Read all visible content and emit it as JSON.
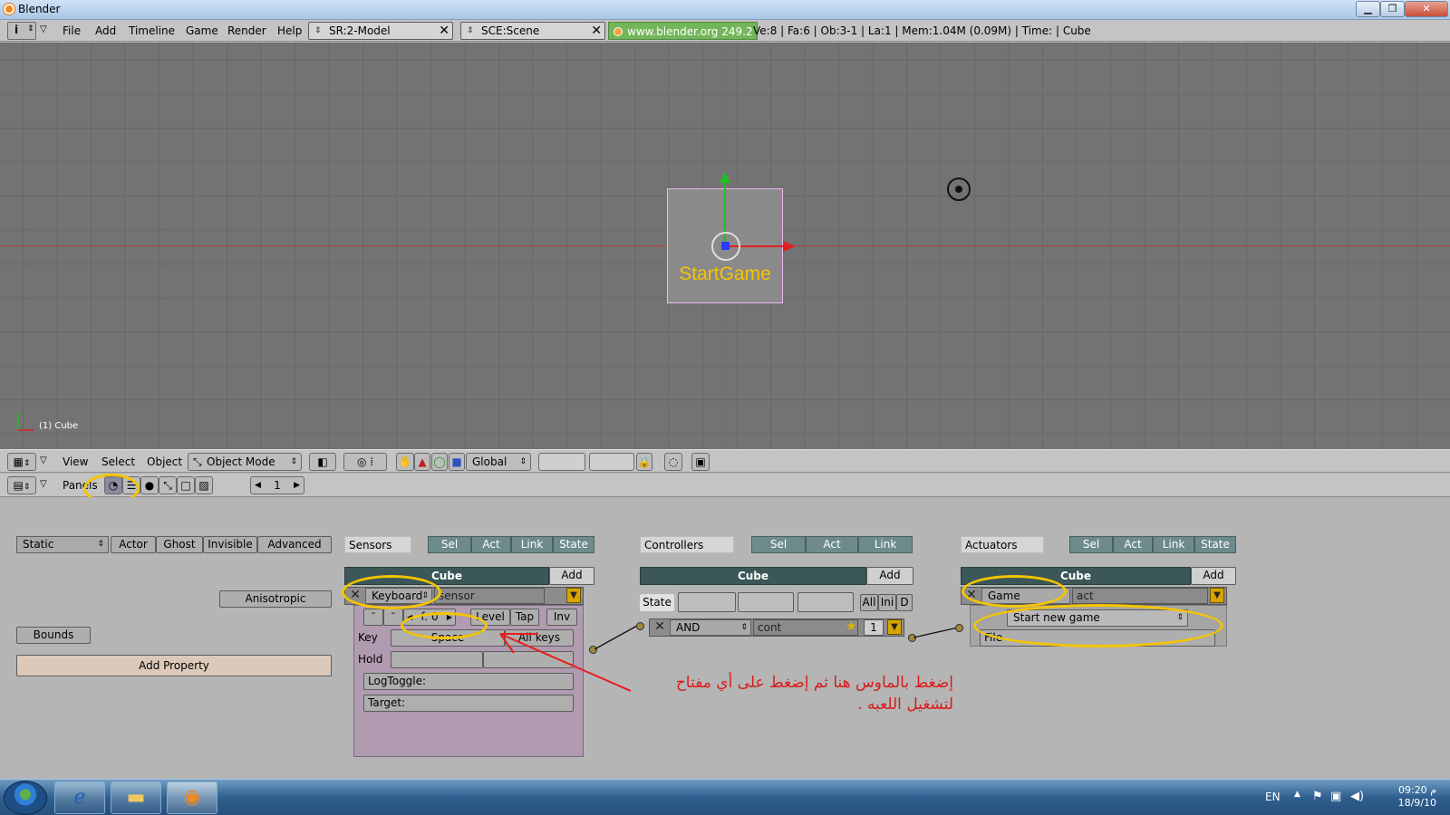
{
  "window": {
    "title": "Blender",
    "min": "▁",
    "max": "❐",
    "close": "✕"
  },
  "infobar": {
    "menus": [
      "File",
      "Add",
      "Timeline",
      "Game",
      "Render",
      "Help"
    ],
    "screen": "SR:2-Model",
    "scene": "SCE:Scene",
    "site": "www.blender.org 249.2",
    "stats": "Ve:8 | Fa:6 | Ob:3-1 | La:1  | Mem:1.04M (0.09M)  | Time: | Cube"
  },
  "viewport": {
    "object_label": "StartGame",
    "object_name": "(1) Cube"
  },
  "view_header": {
    "menus": [
      "View",
      "Select",
      "Object"
    ],
    "mode": "Object Mode",
    "orientation": "Global"
  },
  "buttons_header": {
    "panels_label": "Panels",
    "frame": "1"
  },
  "physics": {
    "type": "Static",
    "buttons": [
      "Actor",
      "Ghost",
      "Invisible",
      "Advanced"
    ],
    "anisotropic": "Anisotropic",
    "bounds": "Bounds",
    "add_property": "Add Property"
  },
  "sensors": {
    "title": "Sensors",
    "toggles": [
      "Sel",
      "Act",
      "Link",
      "State"
    ],
    "object": "Cube",
    "add": "Add",
    "type": "Keyboard",
    "name": "sensor",
    "freq": "f: 0",
    "level": "Level",
    "tap": "Tap",
    "inv": "Inv",
    "key_label": "Key",
    "key_value": "Space",
    "all_keys": "All keys",
    "hold_label": "Hold",
    "logtoggle": "LogToggle:",
    "target": "Target:"
  },
  "controllers": {
    "title": "Controllers",
    "toggles": [
      "Sel",
      "Act",
      "Link"
    ],
    "object": "Cube",
    "add": "Add",
    "state_label": "State",
    "state_buttons": [
      "All",
      "Ini",
      "D"
    ],
    "type": "AND",
    "name": "cont",
    "priority": "1"
  },
  "actuators": {
    "title": "Actuators",
    "toggles": [
      "Sel",
      "Act",
      "Link",
      "State"
    ],
    "object": "Cube",
    "add": "Add",
    "type": "Game",
    "name": "act",
    "mode": "Start new game",
    "file_label": "File"
  },
  "annotation": {
    "line1": "إضغط بالماوس هنا ثم إضغط على أي مفتاح",
    "line2": "لتشغيل اللعبه ."
  },
  "taskbar": {
    "lang": "EN",
    "time": "09:20 م",
    "date": "18/9/10"
  },
  "colors": {
    "annotation_circle": "#f5c400",
    "annotation_text": "#d81c1c",
    "logic_header": "#3b5757"
  }
}
